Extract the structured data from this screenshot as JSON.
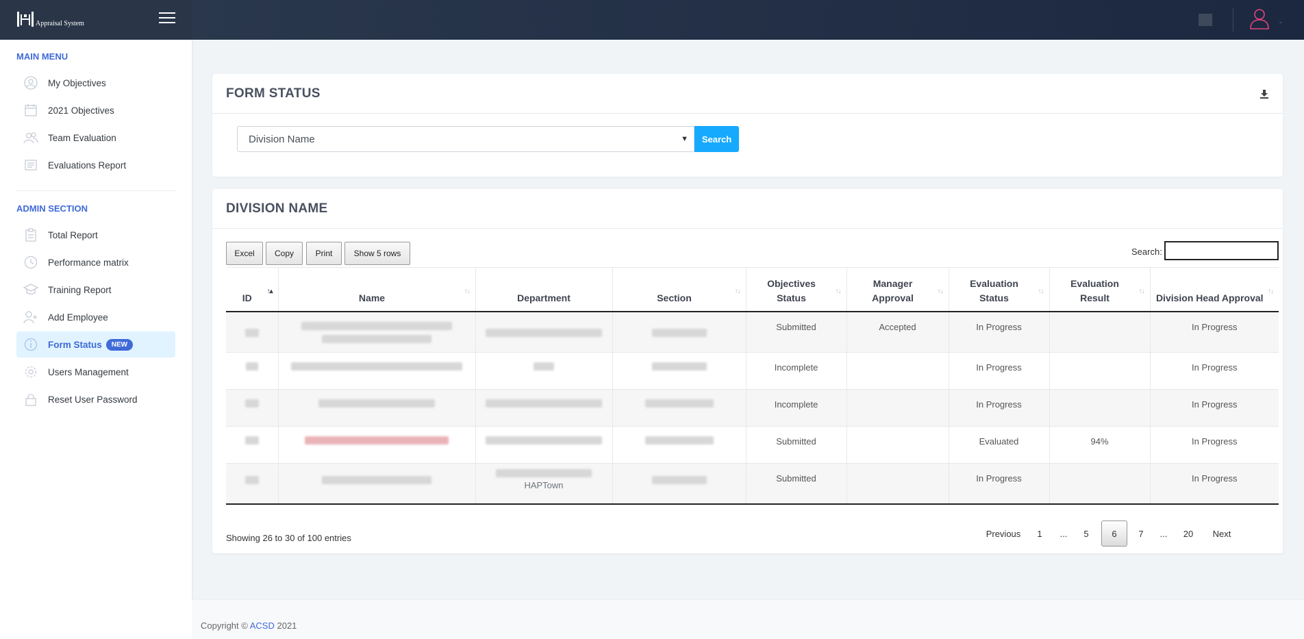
{
  "app": {
    "title": "Appraisal System",
    "logo_letters": "HH"
  },
  "sidebar": {
    "main_heading": "MAIN MENU",
    "main_items": [
      {
        "label": "My Objectives",
        "icon": "user-circle-icon"
      },
      {
        "label": "2021 Objectives",
        "icon": "calendar-icon"
      },
      {
        "label": "Team Evaluation",
        "icon": "users-icon"
      },
      {
        "label": "Evaluations Report",
        "icon": "report-icon"
      }
    ],
    "admin_heading": "ADMIN SECTION",
    "admin_items": [
      {
        "label": "Total Report",
        "icon": "clipboard-icon"
      },
      {
        "label": "Performance matrix",
        "icon": "clock-icon"
      },
      {
        "label": "Training Report",
        "icon": "graduation-cap-icon"
      },
      {
        "label": "Add Employee",
        "icon": "add-user-icon"
      },
      {
        "label": "Form Status",
        "icon": "info-icon",
        "badge": "NEW",
        "active": true
      },
      {
        "label": "Users Management",
        "icon": "gear-icon"
      },
      {
        "label": "Reset User Password",
        "icon": "lock-icon"
      }
    ]
  },
  "form_status": {
    "title": "FORM STATUS",
    "select_value": "Division Name",
    "search_label": "Search"
  },
  "division": {
    "title": "DIVISION NAME",
    "buttons": {
      "excel": "Excel",
      "copy": "Copy",
      "print": "Print",
      "show_rows": "Show 5 rows"
    },
    "search_label": "Search:",
    "search_value": "",
    "columns": [
      "ID",
      "Name",
      "Department",
      "Section",
      "Objectives Status",
      "Manager Approval",
      "Evaluation Status",
      "Evaluation Result",
      "Division Head Approval"
    ],
    "rows": [
      {
        "objectives_status": "Submitted",
        "manager_approval": "Accepted",
        "evaluation_status": "In Progress",
        "evaluation_result": "",
        "division_head_approval": "In Progress"
      },
      {
        "objectives_status": "Incomplete",
        "manager_approval": "",
        "evaluation_status": "In Progress",
        "evaluation_result": "",
        "division_head_approval": "In Progress"
      },
      {
        "objectives_status": "Incomplete",
        "manager_approval": "",
        "evaluation_status": "In Progress",
        "evaluation_result": "",
        "division_head_approval": "In Progress"
      },
      {
        "objectives_status": "Submitted",
        "manager_approval": "",
        "evaluation_status": "Evaluated",
        "evaluation_result": "94%",
        "division_head_approval": "In Progress"
      },
      {
        "objectives_status": "Submitted",
        "manager_approval": "",
        "evaluation_status": "In Progress",
        "evaluation_result": "",
        "division_head_approval": "In Progress",
        "department_partial": "HAPTown"
      }
    ],
    "info": "Showing 26 to 30 of 100 entries",
    "pagination": {
      "previous": "Previous",
      "pages": [
        "1",
        "...",
        "5",
        "6",
        "7",
        "...",
        "20"
      ],
      "current": "6",
      "next": "Next"
    }
  },
  "footer": {
    "prefix": "Copyright ©",
    "link": "ACSD",
    "year": "2021"
  },
  "colors": {
    "accent": "#3f6ad8",
    "search_button": "#16aaff",
    "success": "#3ac47d",
    "danger": "#d92550",
    "header_dark": "#1c2840"
  }
}
